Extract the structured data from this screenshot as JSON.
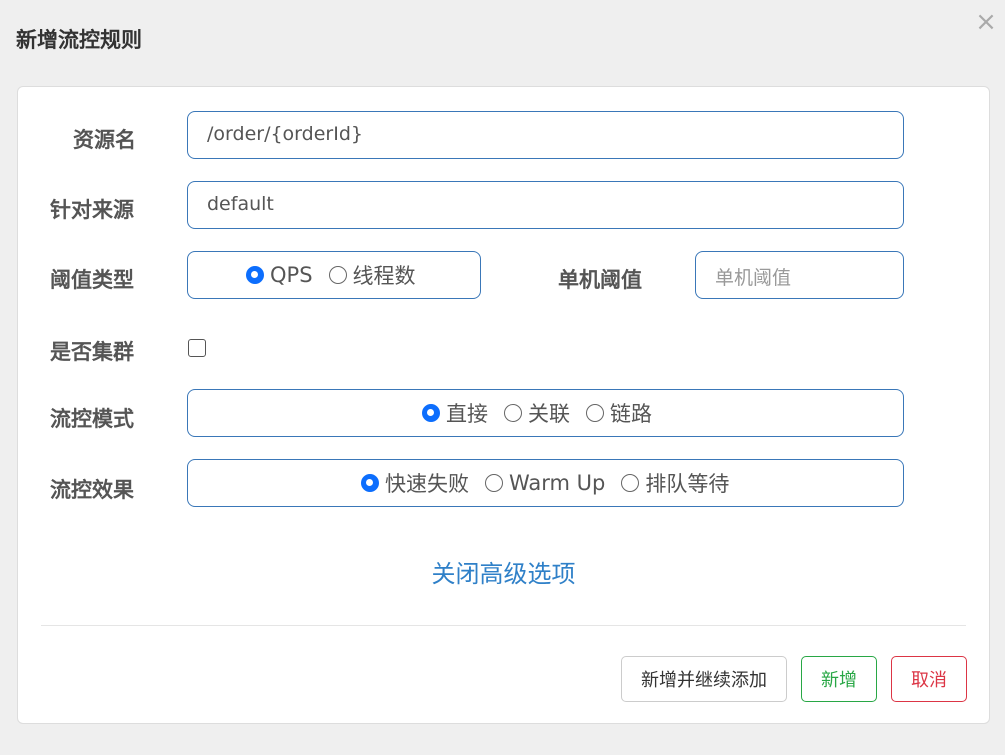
{
  "dialog": {
    "title": "新增流控规则",
    "close_glyph": "×"
  },
  "form": {
    "resource_name": {
      "label": "资源名",
      "value": "/order/{orderId}"
    },
    "limit_app": {
      "label": "针对来源",
      "value": "default"
    },
    "threshold_type": {
      "label": "阈值类型",
      "options": [
        "QPS",
        "线程数"
      ],
      "selected": "QPS"
    },
    "single_threshold": {
      "label": "单机阈值",
      "placeholder": "单机阈值",
      "value": ""
    },
    "cluster_mode": {
      "label": "是否集群",
      "checked": false
    },
    "control_mode": {
      "label": "流控模式",
      "options": [
        "直接",
        "关联",
        "链路"
      ],
      "selected": "直接"
    },
    "control_effect": {
      "label": "流控效果",
      "options": [
        "快速失败",
        "Warm Up",
        "排队等待"
      ],
      "selected": "快速失败"
    },
    "advanced_toggle": "关闭高级选项"
  },
  "footer": {
    "add_continue_label": "新增并继续添加",
    "add_label": "新增",
    "cancel_label": "取消"
  },
  "colors": {
    "accent": "#0d6efd",
    "input_border": "#3a77b8",
    "link": "#2f80c8",
    "success": "#28a745",
    "danger": "#dc3545"
  }
}
